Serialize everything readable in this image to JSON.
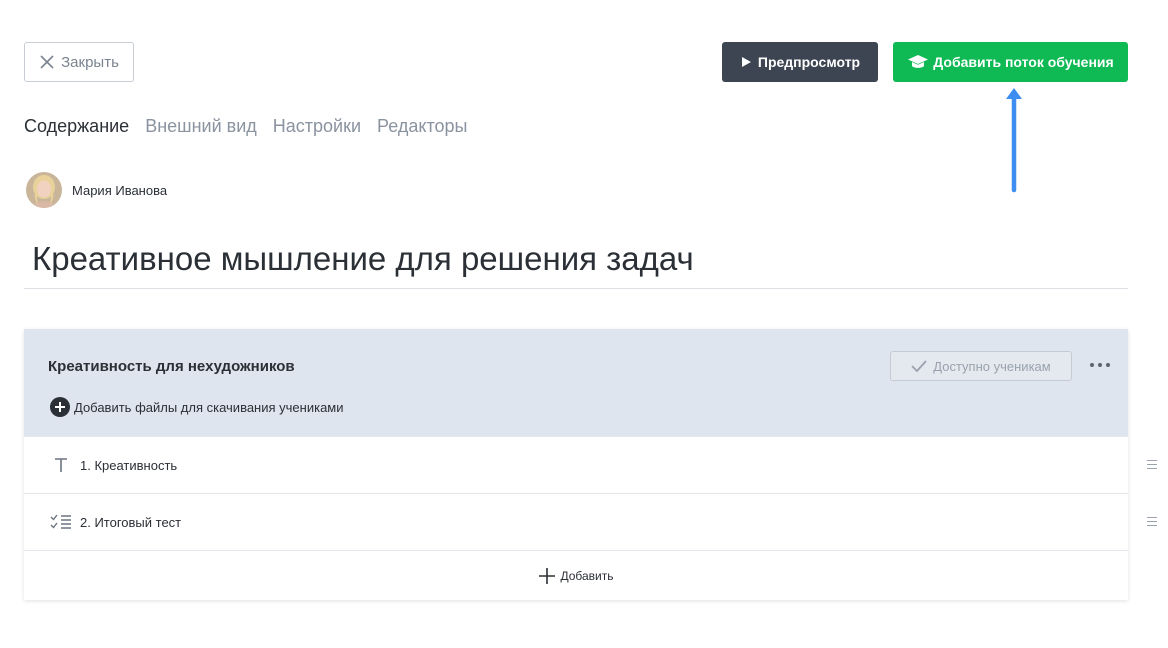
{
  "header": {
    "close_label": "Закрыть",
    "preview_label": "Предпросмотр",
    "add_flow_label": "Добавить поток обучения"
  },
  "tabs": [
    {
      "label": "Содержание",
      "active": true
    },
    {
      "label": "Внешний вид",
      "active": false
    },
    {
      "label": "Настройки",
      "active": false
    },
    {
      "label": "Редакторы",
      "active": false
    }
  ],
  "author": {
    "name": "Мария Иванова"
  },
  "course": {
    "title": "Креативное мышление для решения задач"
  },
  "module": {
    "title": "Креативность для нехудожников",
    "add_files_label": "Добавить файлы для скачивания учениками",
    "access_label": "Доступно ученикам",
    "lessons": [
      {
        "label": "1. Креативность",
        "icon": "text-icon"
      },
      {
        "label": "2. Итоговый тест",
        "icon": "checklist-icon"
      }
    ],
    "add_label": "Добавить"
  },
  "colors": {
    "accent_green": "#0fb954",
    "dark_button": "#3d4452",
    "module_header_bg": "#dfe5ee",
    "annotation_arrow": "#3d8ef0"
  }
}
